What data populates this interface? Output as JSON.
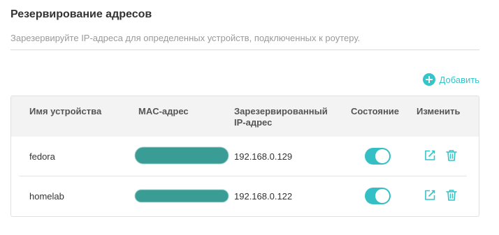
{
  "section": {
    "title": "Резервирование адресов",
    "description": "Зарезервируйте IP-адреса для определенных устройств, подключенных к роутеру."
  },
  "actions": {
    "add_label": "Добавить",
    "add_icon": "plus-circle-icon"
  },
  "colors": {
    "accent": "#33c5c9",
    "toggle_on": "#33bfc4",
    "header_bg": "#f3f3f3",
    "redaction": "#3a9d95"
  },
  "table": {
    "headers": {
      "name": "Имя устройства",
      "mac": "MAC-адрес",
      "ip": "Зарезервированный IP-адрес",
      "state": "Состояние",
      "edit": "Изменить"
    },
    "rows": [
      {
        "name": "fedora",
        "mac": "",
        "ip": "192.168.0.129",
        "enabled": true
      },
      {
        "name": "homelab",
        "mac": "",
        "ip": "192.168.0.122",
        "enabled": true
      }
    ]
  }
}
